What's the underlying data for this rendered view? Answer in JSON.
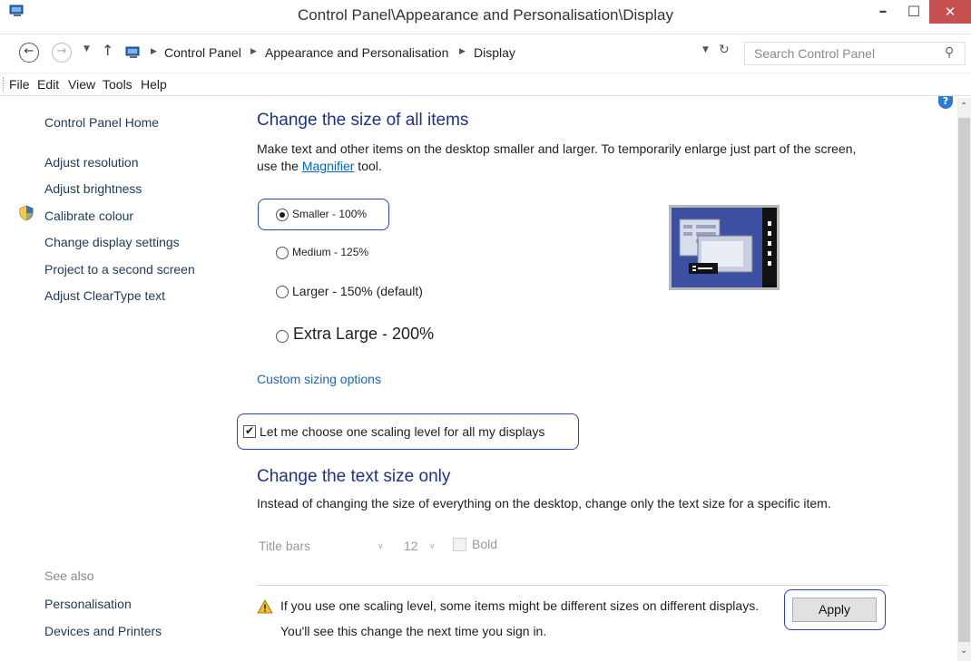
{
  "window": {
    "title": "Control Panel\\Appearance and Personalisation\\Display",
    "min_glyph": "–",
    "max_glyph": "☐",
    "close_glyph": "✕"
  },
  "address": {
    "breadcrumbs": [
      "Control Panel",
      "Appearance and Personalisation",
      "Display"
    ],
    "search_placeholder": "Search Control Panel"
  },
  "menu": [
    "File",
    "Edit",
    "View",
    "Tools",
    "Help"
  ],
  "left_pane": {
    "links": [
      "Control Panel Home",
      "Adjust resolution",
      "Adjust brightness",
      "Calibrate colour",
      "Change display settings",
      "Project to a second screen",
      "Adjust ClearType text"
    ],
    "see_also_label": "See also",
    "see_also_links": [
      "Personalisation",
      "Devices and Printers"
    ]
  },
  "size_section": {
    "heading": "Change the size of all items",
    "desc_line1": "Make text and other items on the desktop smaller and larger. To temporarily enlarge just part of the screen,",
    "desc_pre": "use the ",
    "desc_link": "Magnifier",
    "desc_post": " tool.",
    "options": [
      {
        "label": "Smaller - 100%",
        "selected": true
      },
      {
        "label": "Medium - 125%",
        "selected": false
      },
      {
        "label": "Larger - 150% (default)",
        "selected": false
      },
      {
        "label": "Extra Large - 200%",
        "selected": false
      }
    ],
    "custom_link": "Custom sizing options",
    "checkbox_label": "Let me choose one scaling level for all my displays",
    "checkbox_checked": true
  },
  "text_section": {
    "heading": "Change the text size only",
    "desc": "Instead of changing the size of everything on the desktop, change only the text size for a specific item.",
    "item_value": "Title bars",
    "size_value": "12",
    "bold_label": "Bold"
  },
  "footer": {
    "warning": "If you use one scaling level, some items might be different sizes on different displays.",
    "signin_note": "You'll see this change the next time you sign in.",
    "apply_label": "Apply"
  },
  "colors": {
    "heading": "#1e3287",
    "link": "#1a66c5",
    "highlight": "#2b3fc8",
    "close": "#c75050"
  }
}
